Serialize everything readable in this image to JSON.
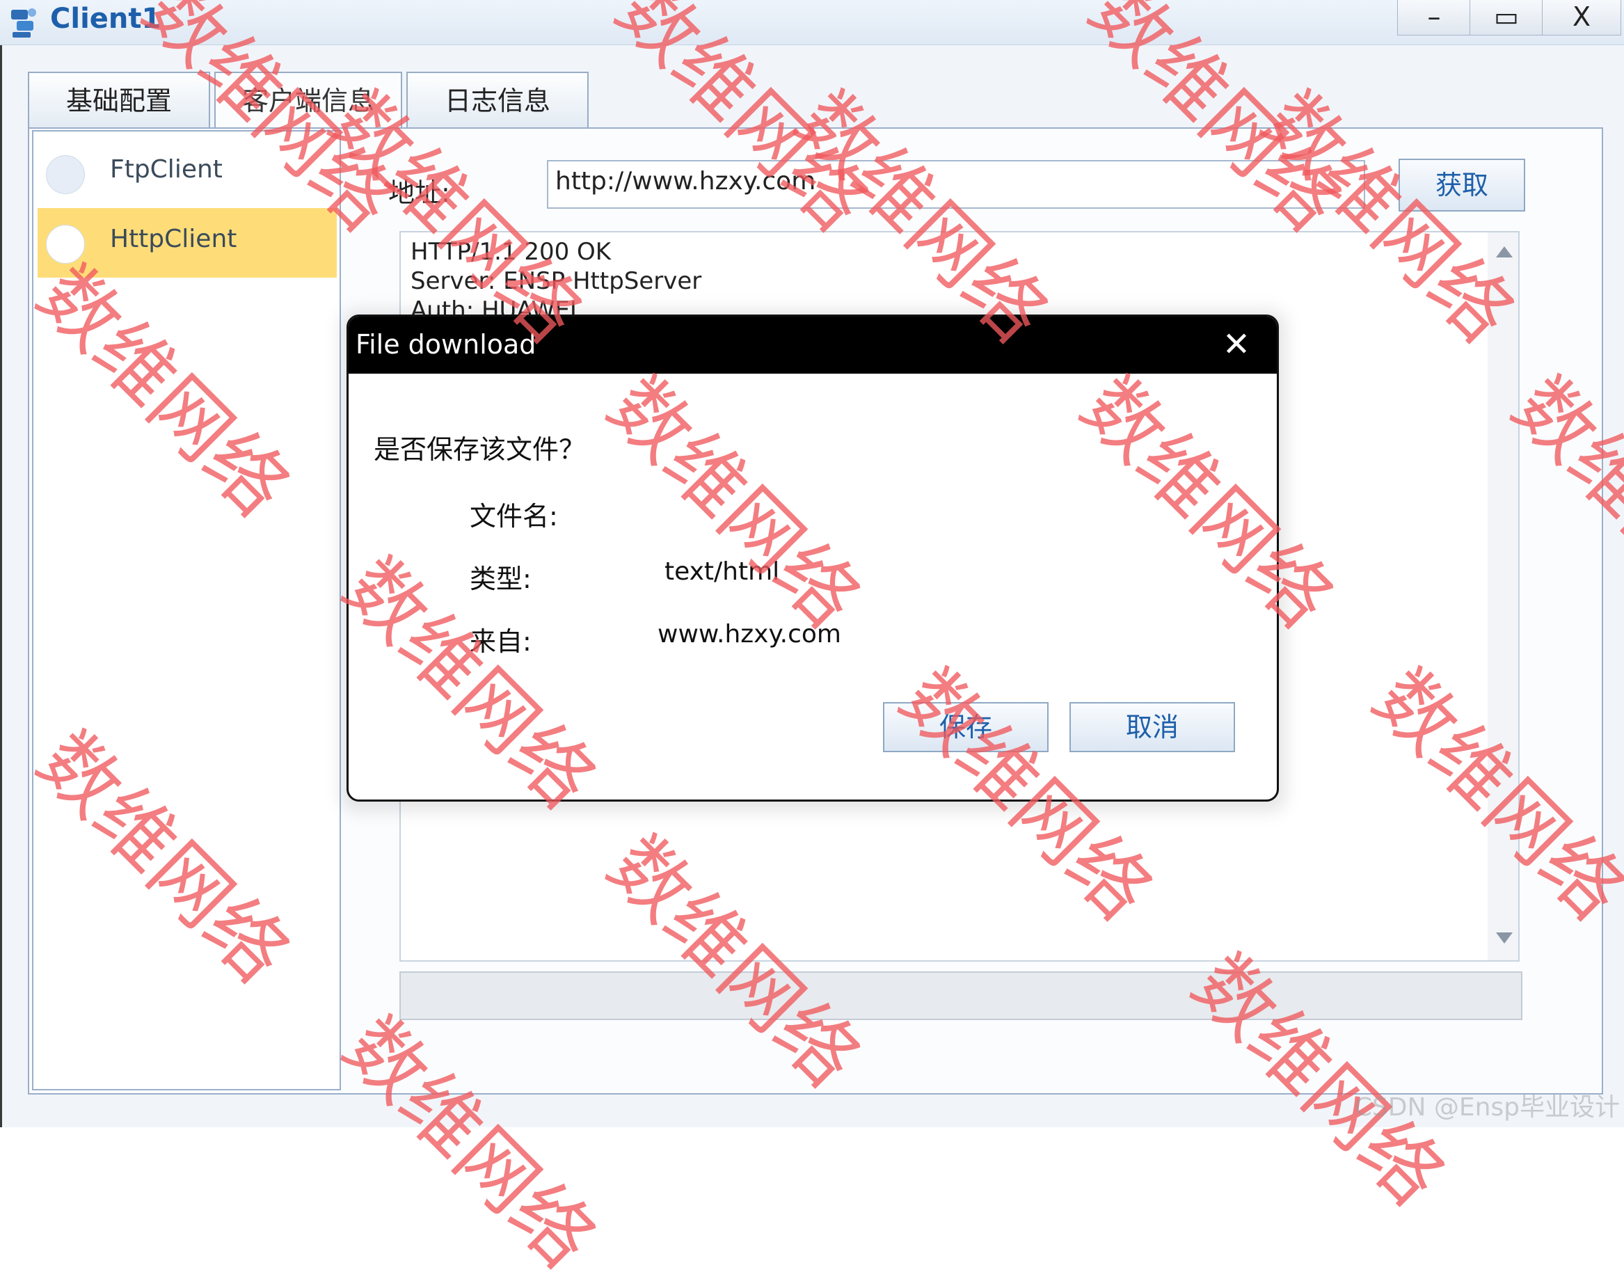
{
  "window": {
    "title": "Client1",
    "buttons": {
      "minimize": "–",
      "maximize": "▭",
      "close": "X"
    }
  },
  "tabs": [
    {
      "label": "基础配置",
      "active": false
    },
    {
      "label": "客户端信息",
      "active": true
    },
    {
      "label": "日志信息",
      "active": false
    }
  ],
  "sidebar": {
    "items": [
      {
        "label": "FtpClient",
        "selected": false
      },
      {
        "label": "HttpClient",
        "selected": true
      }
    ]
  },
  "http": {
    "address_label": "地址:",
    "address_value": "http://www.hzxy.com",
    "fetch_button": "获取",
    "response_lines": [
      "HTTP/1.1 200 OK",
      "Server: ENSP HttpServer",
      "Auth: HUAWEI"
    ]
  },
  "dialog": {
    "title": "File download",
    "close_label": "✕",
    "question": "是否保存该文件？",
    "filename_label": "文件名:",
    "filename_value": "",
    "type_label": "类型:",
    "type_value": "text/html",
    "from_label": "来自:",
    "from_value": "www.hzxy.com",
    "save_button": "保存",
    "cancel_button": "取消"
  },
  "watermark": {
    "text": "数维网络",
    "corner": "CSDN @Ensp毕业设计",
    "color": "#f0585c"
  }
}
